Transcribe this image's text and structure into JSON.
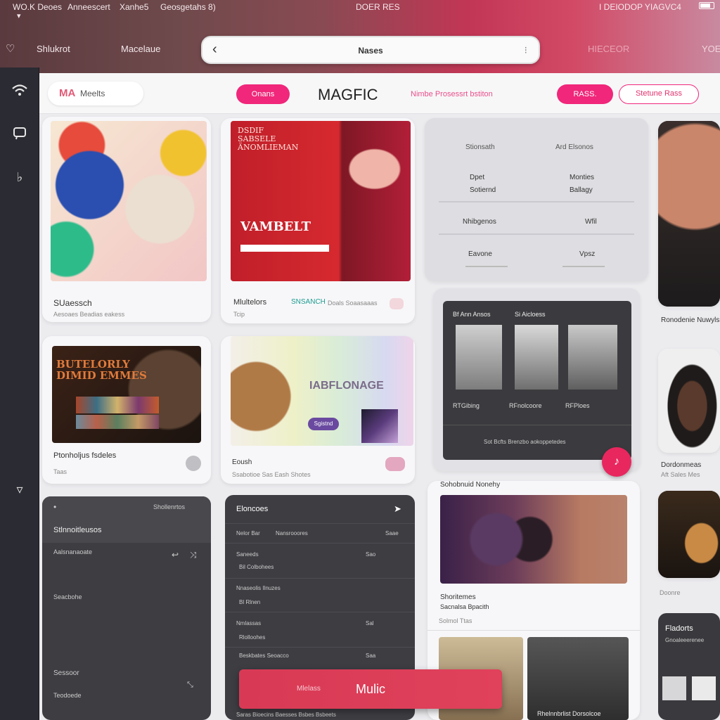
{
  "status_bar": {
    "left_text": "WO.K Deoes",
    "app_text": "Anneescert",
    "nav_text": "Xanhe5",
    "time_text": "Geosgetahs 8)",
    "center_text": "DOER RES",
    "right_text": "I DEIODOP YIAGVC4"
  },
  "nav_bar": {
    "item_1": "Shlukrot",
    "item_2": "Macelaue",
    "address_title": "Nases",
    "right_item_1": "HIECEOR",
    "right_item_2": "YOE"
  },
  "top_bar": {
    "logo_mark": "MA",
    "logo_text": "Meelts",
    "btn_1": "Onans",
    "brand": "MAGFIC",
    "link": "Nimbe Prosessrt bstiton",
    "btn_2": "RASS.",
    "btn_3": "Stetune Rass"
  },
  "cards": {
    "c1_title": "SUaessch",
    "c1_sub": "Aesoaes Beadias eakess",
    "c2_poster_top": "DSDIF SABSELE ÄNOMLIEMAN",
    "c2_poster_main": "VAMBELT",
    "c2_footer_left": "Mlultelors",
    "c2_footer_teal": "SNSANCH",
    "c2_footer_rest": "Doals Soaasaaas",
    "c2_sub": "Tcip",
    "c3_poster": "BUTELORLY DIMID EMMES",
    "c3_title": "Ptonholjus fsdeles",
    "c3_sub": "Taas",
    "c4_hero": "IABFLONAGE",
    "c4_btn": "Sgistnd",
    "c4_title": "Eoush",
    "c4_sub": "Ssabotioe Sas Eash Shotes"
  },
  "list_panel": {
    "h1": "Stionsath",
    "h2": "Ard Elsonos",
    "r1a": "Dpet Sotiernd",
    "r1b": "Monties Ballagy",
    "r2a": "Nhibgenos",
    "r2b": "Wfil",
    "r3a": "Eavone",
    "r3b": "Vpsz"
  },
  "gallery_panel": {
    "h1": "Bf Ann Ansos",
    "h2": "Si Aicloess",
    "n1": "RTGibing",
    "n2": "RFnolcoore",
    "n3": "RFPloes",
    "footer": "Sot Bcfts Brenzbo aokoppetedes"
  },
  "feature_card": {
    "header": "Sohobnuid Nonehy",
    "title": "Shoritemes",
    "subtitle": "Sacnalsa Bpacith",
    "meta": "Solmol Ttas",
    "bottom_caption": "Rhelnnbrlist Dorsolcoe"
  },
  "right_column": {
    "r1_title": "Ronodenie Nuwyls",
    "r2_title": "Dordonmeas",
    "r2_sub": "Aft Sales Mes",
    "r3_title": "Doonre",
    "r4_title": "Fladorts",
    "r4_sub": "Gnoaleeerenee"
  },
  "dark_panel_1": {
    "header_right": "Shollenrtos",
    "title": "Stlnnoitleusos",
    "row_1": "Aalsnanaoate",
    "row_2": "Seacbohe",
    "row_3": "Sessoor",
    "row_4": "Teodoede"
  },
  "dark_panel_2": {
    "title": "Eloncoes",
    "rows": [
      {
        "a": "Nelor Bar",
        "b": "Nansrooores",
        "c": "Saae"
      },
      {
        "a": "Saneeds",
        "b": "Bil Colbohees",
        "c": "Sao"
      },
      {
        "a": "Nnaseolis Ilnuzes",
        "b": "",
        "c": ""
      },
      {
        "a": "Bl Rlnen",
        "b": "",
        "c": ""
      },
      {
        "a": "Nmlassas",
        "b": "",
        "c": "Sal"
      },
      {
        "a": "Rlolloohes",
        "b": "",
        "c": ""
      },
      {
        "a": "Beskbates Seoacco",
        "b": "",
        "c": "Saa"
      }
    ],
    "footer": "Saras Bioecins Baesses Bsbes Bsbeets"
  },
  "music_button": {
    "small_label": "Mlelass",
    "label": "Mulic"
  },
  "colors": {
    "accent": "#f0277a",
    "primary_red": "#e0415b",
    "dark_panel": "#3d3d42",
    "rail": "#2b2b33"
  }
}
